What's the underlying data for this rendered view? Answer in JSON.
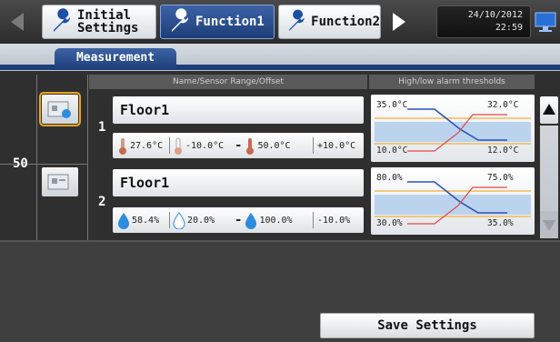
{
  "header": {
    "tabs": [
      {
        "label_line1": "Initial",
        "label_line2": "Settings"
      },
      {
        "label": "Function1"
      },
      {
        "label": "Function2"
      }
    ],
    "date": "24/10/2012",
    "time": "22:59"
  },
  "subtab": {
    "label": "Measurement"
  },
  "table": {
    "col_name": "Name/Sensor Range/Offset",
    "col_thresholds": "High/low alarm thresholds",
    "group_number": "50",
    "rows": [
      {
        "number": "1",
        "name": "Floor1",
        "measured": "27.6°C",
        "range_low": "-10.0°C",
        "range_high": "50.0°C",
        "offset": "+10.0°C",
        "thr_high_on": "35.0°C",
        "thr_high_off": "32.0°C",
        "thr_low_on": "10.0°C",
        "thr_low_off": "12.0°C"
      },
      {
        "number": "2",
        "name": "Floor1",
        "measured": "58.4%",
        "range_low": "20.0%",
        "range_high": "100.0%",
        "offset": "-10.0%",
        "thr_high_on": "80.0%",
        "thr_high_off": "75.0%",
        "thr_low_on": "30.0%",
        "thr_low_off": "35.0%"
      }
    ]
  },
  "footer": {
    "save_label": "Save Settings"
  },
  "colors": {
    "accent_blue": "#1d3e79",
    "selected_orange": "#f4a51c"
  }
}
